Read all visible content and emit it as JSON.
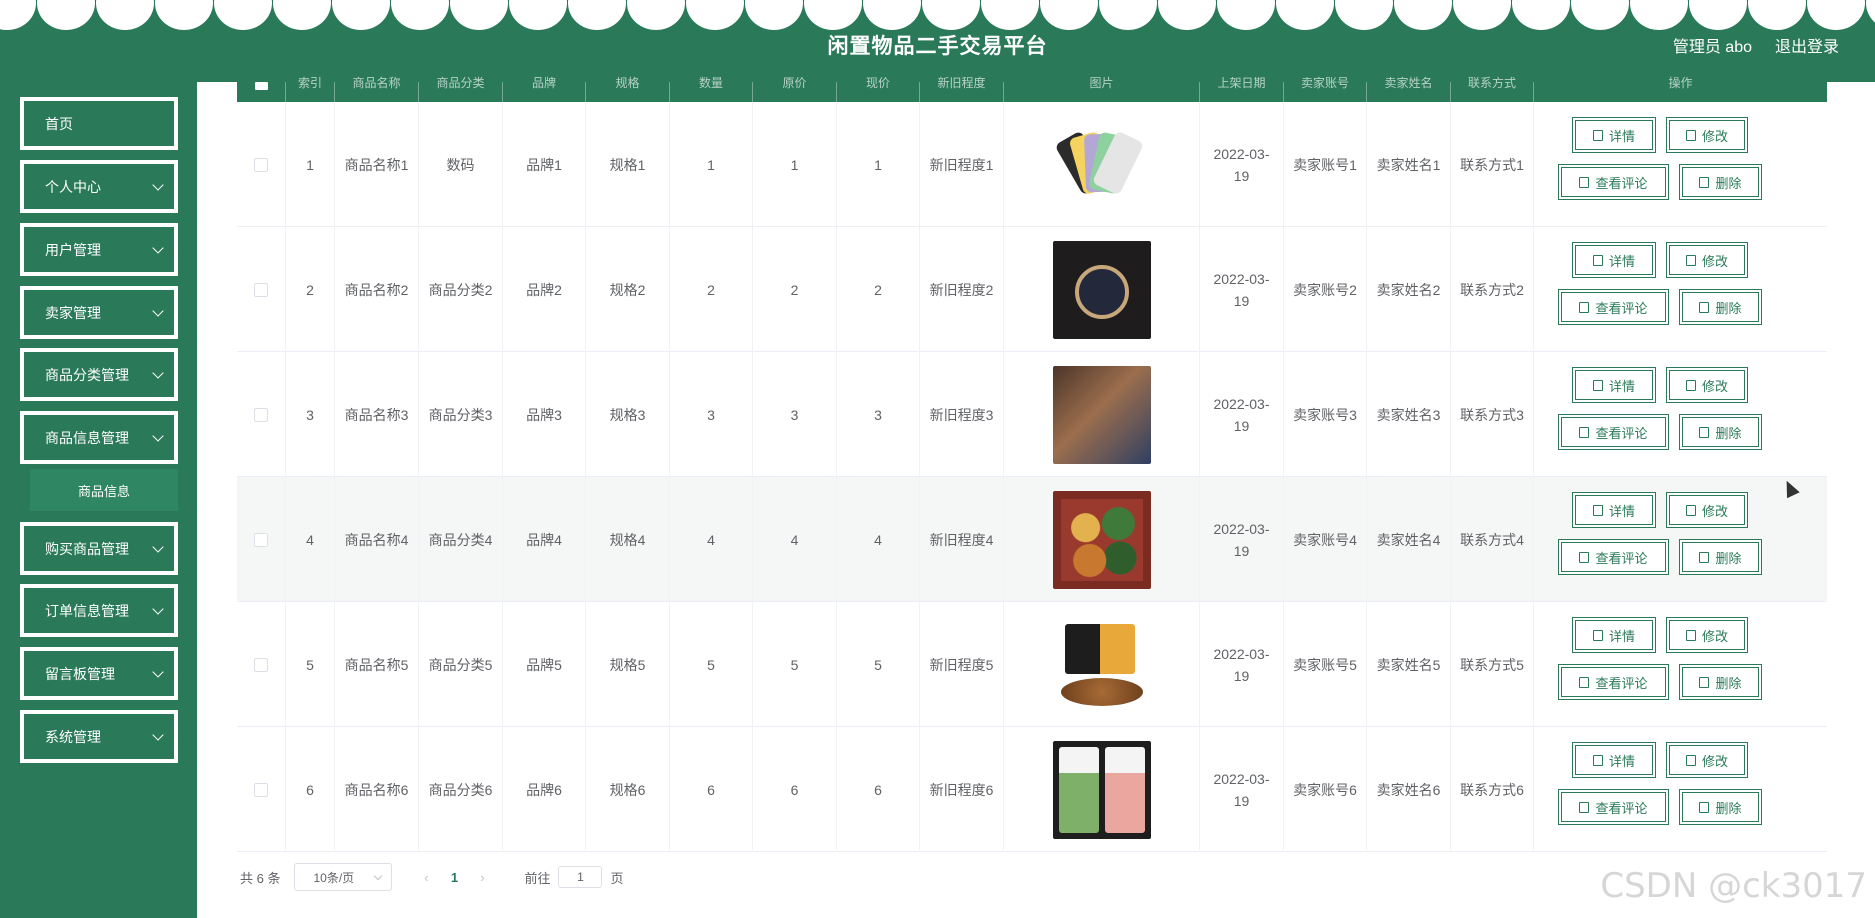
{
  "header": {
    "title": "闲置物品二手交易平台",
    "user": "管理员 abo",
    "logout": "退出登录"
  },
  "sidebar": {
    "items": [
      {
        "label": "首页"
      },
      {
        "label": "个人中心"
      },
      {
        "label": "用户管理"
      },
      {
        "label": "卖家管理"
      },
      {
        "label": "商品分类管理"
      },
      {
        "label": "商品信息管理"
      },
      {
        "label": "购买商品管理"
      },
      {
        "label": "订单信息管理"
      },
      {
        "label": "留言板管理"
      },
      {
        "label": "系统管理"
      }
    ],
    "subitem": "商品信息"
  },
  "table": {
    "headers": [
      "索引",
      "商品名称",
      "商品分类",
      "品牌",
      "规格",
      "数量",
      "原价",
      "现价",
      "新旧程度",
      "图片",
      "上架日期",
      "卖家账号",
      "卖家姓名",
      "联系方式",
      "操作"
    ],
    "rows": [
      {
        "idx": "1",
        "name": "商品名称1",
        "cat": "数码",
        "brand": "品牌1",
        "spec": "规格1",
        "qty": "1",
        "orig": "1",
        "now": "1",
        "cond": "新旧程度1",
        "image": "phone-image",
        "date": "2022-03-19",
        "acct": "卖家账号1",
        "seller": "卖家姓名1",
        "contact": "联系方式1"
      },
      {
        "idx": "2",
        "name": "商品名称2",
        "cat": "商品分类2",
        "brand": "品牌2",
        "spec": "规格2",
        "qty": "2",
        "orig": "2",
        "now": "2",
        "cond": "新旧程度2",
        "image": "watch-image",
        "date": "2022-03-19",
        "acct": "卖家账号2",
        "seller": "卖家姓名2",
        "contact": "联系方式2"
      },
      {
        "idx": "3",
        "name": "商品名称3",
        "cat": "商品分类3",
        "brand": "品牌3",
        "spec": "规格3",
        "qty": "3",
        "orig": "3",
        "now": "3",
        "cond": "新旧程度3",
        "image": "bag-image",
        "date": "2022-03-19",
        "acct": "卖家账号3",
        "seller": "卖家姓名3",
        "contact": "联系方式3"
      },
      {
        "idx": "4",
        "name": "商品名称4",
        "cat": "商品分类4",
        "brand": "品牌4",
        "spec": "规格4",
        "qty": "4",
        "orig": "4",
        "now": "4",
        "cond": "新旧程度4",
        "image": "food-image",
        "date": "2022-03-19",
        "acct": "卖家账号4",
        "seller": "卖家姓名4",
        "contact": "联系方式4"
      },
      {
        "idx": "5",
        "name": "商品名称5",
        "cat": "商品分类5",
        "brand": "品牌5",
        "spec": "规格5",
        "qty": "5",
        "orig": "5",
        "now": "5",
        "cond": "新旧程度5",
        "image": "snack-image",
        "date": "2022-03-19",
        "acct": "卖家账号5",
        "seller": "卖家姓名5",
        "contact": "联系方式5"
      },
      {
        "idx": "6",
        "name": "商品名称6",
        "cat": "商品分类6",
        "brand": "品牌6",
        "spec": "规格6",
        "qty": "6",
        "orig": "6",
        "now": "6",
        "cond": "新旧程度6",
        "image": "package-image",
        "date": "2022-03-19",
        "acct": "卖家账号6",
        "seller": "卖家姓名6",
        "contact": "联系方式6"
      }
    ],
    "actions": {
      "detail": "详情",
      "edit": "修改",
      "comments": "查看评论",
      "delete": "删除"
    }
  },
  "pagination": {
    "total": "共 6 条",
    "page_size": "10条/页",
    "current": "1",
    "goto_prefix": "前往",
    "goto_value": "1",
    "goto_suffix": "页"
  },
  "watermark": "CSDN @ck3017",
  "colors": {
    "primary": "#2a7a5a",
    "text": "#606266"
  }
}
